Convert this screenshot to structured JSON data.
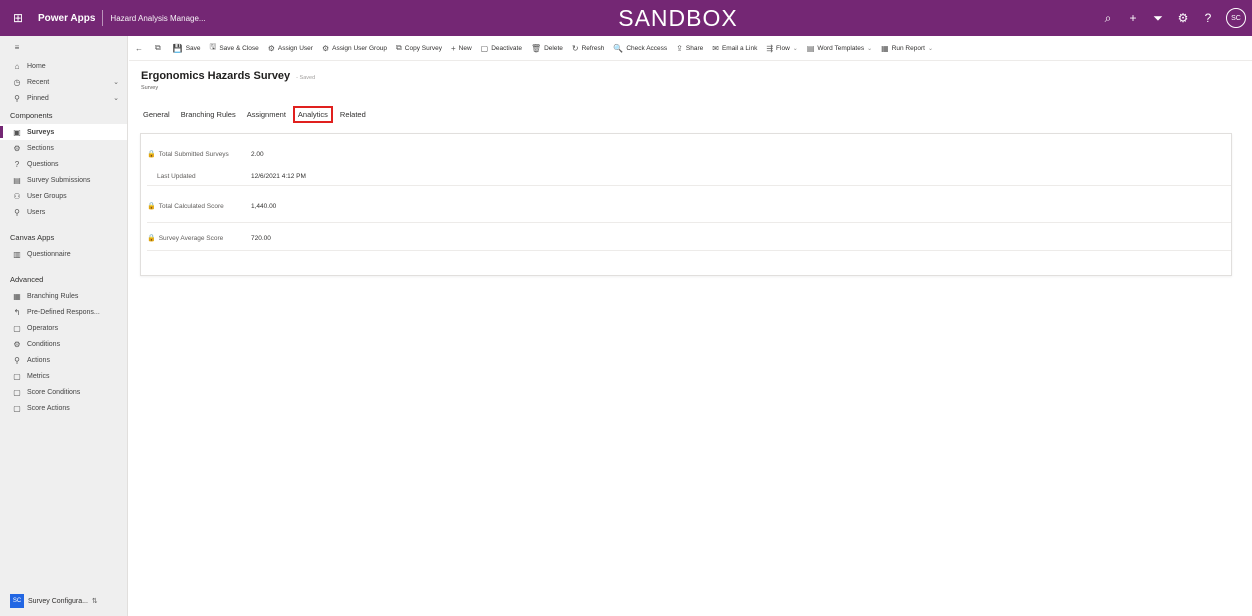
{
  "topbar": {
    "brand": "Power Apps",
    "app_name": "Hazard Analysis Manage...",
    "environment": "SANDBOX",
    "avatar_initials": "SC"
  },
  "sidebar": {
    "items_top": [
      {
        "label": "Home",
        "icon": "home"
      },
      {
        "label": "Recent",
        "icon": "clock",
        "chevron": "⌄"
      },
      {
        "label": "Pinned",
        "icon": "pin",
        "chevron": "⌄"
      }
    ],
    "components_title": "Components",
    "components": [
      {
        "label": "Surveys",
        "icon": "survey",
        "active": true
      },
      {
        "label": "Sections",
        "icon": "sections"
      },
      {
        "label": "Questions",
        "icon": "question"
      },
      {
        "label": "Survey Submissions",
        "icon": "submissions"
      },
      {
        "label": "User Groups",
        "icon": "groups"
      },
      {
        "label": "Users",
        "icon": "user"
      }
    ],
    "canvas_title": "Canvas Apps",
    "canvas": [
      {
        "label": "Questionnaire",
        "icon": "questionnaire"
      }
    ],
    "advanced_title": "Advanced",
    "advanced": [
      {
        "label": "Branching Rules",
        "icon": "rules"
      },
      {
        "label": "Pre-Defined Respons...",
        "icon": "response"
      },
      {
        "label": "Operators",
        "icon": "operators"
      },
      {
        "label": "Conditions",
        "icon": "conditions"
      },
      {
        "label": "Actions",
        "icon": "actions"
      },
      {
        "label": "Metrics",
        "icon": "metrics"
      },
      {
        "label": "Score Conditions",
        "icon": "score-conditions"
      },
      {
        "label": "Score Actions",
        "icon": "score-actions"
      }
    ],
    "bottom_badge": "SC",
    "bottom_label": "Survey Configura..."
  },
  "commands": [
    {
      "label": "Save",
      "icon": "💾"
    },
    {
      "label": "Save & Close",
      "icon": "🖫"
    },
    {
      "label": "Assign User",
      "icon": "⚙"
    },
    {
      "label": "Assign User Group",
      "icon": "⚙"
    },
    {
      "label": "Copy Survey",
      "icon": "⧉"
    },
    {
      "label": "New",
      "icon": "+"
    },
    {
      "label": "Deactivate",
      "icon": "▢"
    },
    {
      "label": "Delete",
      "icon": "🗑"
    },
    {
      "label": "Refresh",
      "icon": "↻"
    },
    {
      "label": "Check Access",
      "icon": "🔍"
    },
    {
      "label": "Share",
      "icon": "⇪"
    },
    {
      "label": "Email a Link",
      "icon": "✉"
    },
    {
      "label": "Flow",
      "icon": "⇶",
      "caret": "⌄"
    },
    {
      "label": "Word Templates",
      "icon": "▤",
      "caret": "⌄"
    },
    {
      "label": "Run Report",
      "icon": "▦",
      "caret": "⌄"
    }
  ],
  "record": {
    "title": "Ergonomics Hazards Survey",
    "state": "- Saved",
    "entity": "Survey"
  },
  "tabs": [
    {
      "label": "General"
    },
    {
      "label": "Branching Rules"
    },
    {
      "label": "Assignment"
    },
    {
      "label": "Analytics",
      "selected": true
    },
    {
      "label": "Related"
    }
  ],
  "analytics": {
    "total_submitted_label": "Total Submitted Surveys",
    "total_submitted_value": "2.00",
    "last_updated_label": "Last Updated",
    "last_updated_value": "12/6/2021 4:12 PM",
    "total_calculated_label": "Total Calculated Score",
    "total_calculated_value": "1,440.00",
    "average_label": "Survey Average Score",
    "average_value": "720.00"
  }
}
